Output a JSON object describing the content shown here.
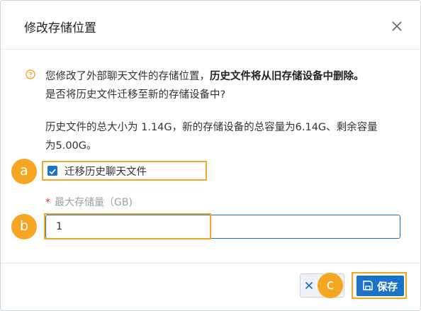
{
  "dialog": {
    "title": "修改存储位置",
    "close_icon": "close-icon"
  },
  "message": {
    "icon": "question-circle-icon",
    "line1_plain": "您修改了外部聊天文件的存储位置，",
    "line1_bold": "历史文件将从旧存储设备中删除。",
    "line2": "是否将历史文件迁移至新的存储设备中?",
    "line3": "历史文件的总大小为 1.14G，新的存储设备的总容量为6.14G、剩余容量",
    "line4": "为5.00G。"
  },
  "migrate": {
    "checked": true,
    "label": "迁移历史聊天文件"
  },
  "max_storage": {
    "required_mark": "*",
    "label": "最大存储量（GB)",
    "value": "1"
  },
  "footer": {
    "save_label": "保存",
    "save_icon": "save-icon",
    "cancel_icon": "close-icon"
  },
  "callouts": {
    "a": "a",
    "b": "b",
    "c": "c"
  },
  "colors": {
    "accent": "#1a73c8",
    "highlight": "#f5a623",
    "required": "#e53935",
    "warning": "#f5a623"
  }
}
